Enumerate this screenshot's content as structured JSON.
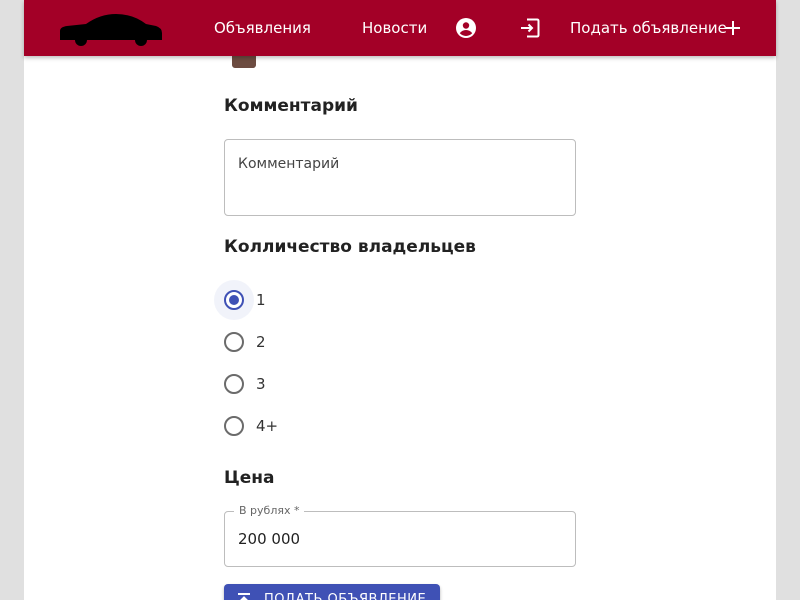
{
  "header": {
    "background": "#a30027",
    "logo_icon": "car-silhouette-icon",
    "nav": {
      "ads": "Объявления",
      "news": "Новости",
      "profile_icon": "account-circle-icon",
      "login_icon": "login-icon",
      "post_ad": "Подать объявление",
      "post_ad_icon": "plus-icon"
    }
  },
  "form": {
    "color_swatch": "#6d4c41",
    "comment": {
      "title": "Комментарий",
      "placeholder": "Комментарий",
      "value": ""
    },
    "owners": {
      "title": "Колличество владельцев",
      "options": [
        "1",
        "2",
        "3",
        "4+"
      ],
      "selected": "1"
    },
    "price": {
      "title": "Цена",
      "label": "В рублях *",
      "value": "200 000"
    },
    "submit": {
      "label": "ПОДАТЬ ОБЪЯВЛЕНИЕ",
      "icon": "upload-icon",
      "color": "#3f51b5"
    }
  }
}
